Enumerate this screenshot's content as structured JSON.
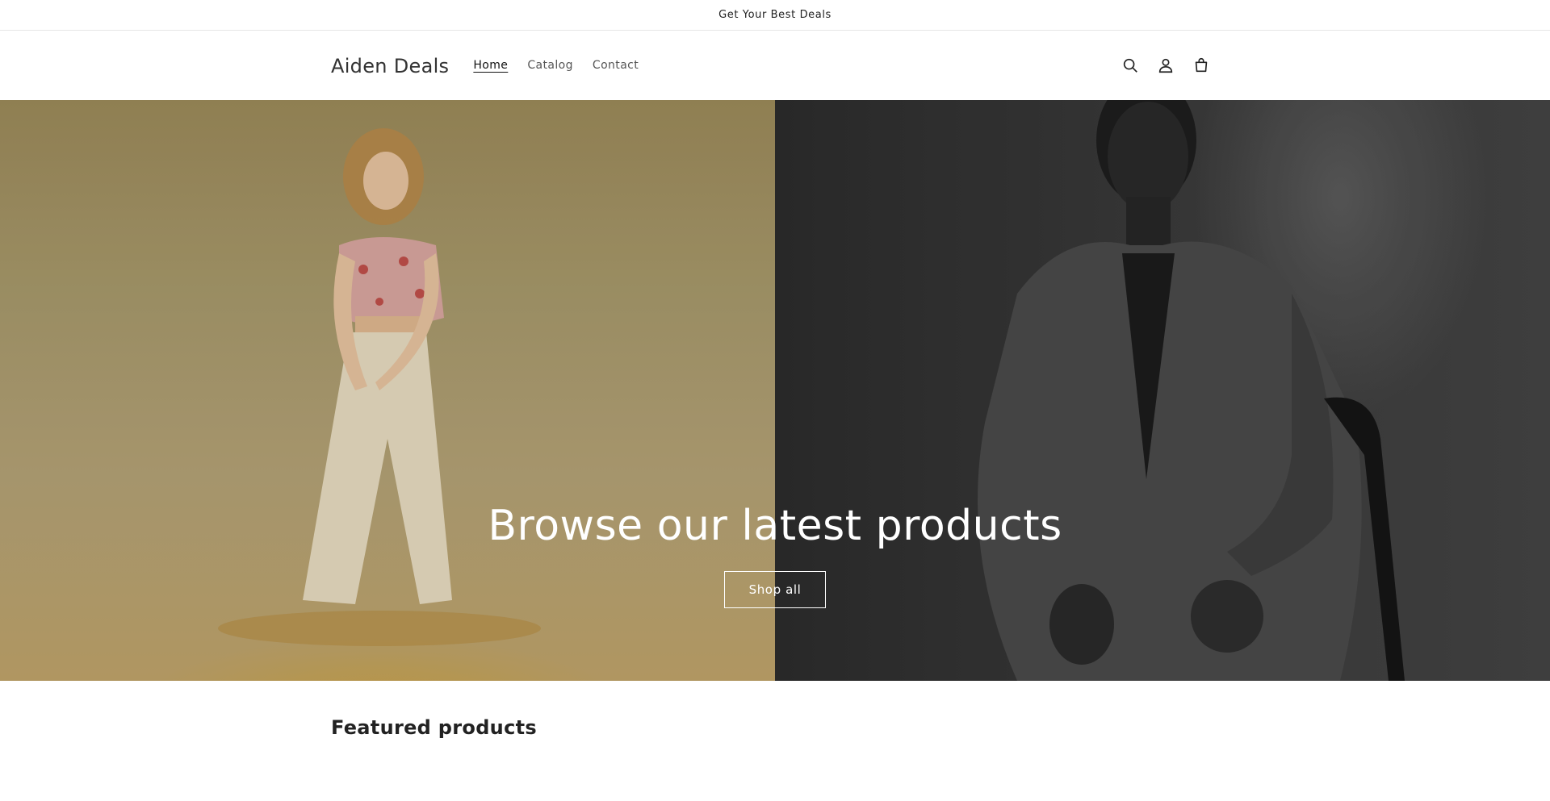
{
  "announcement": {
    "text": "Get Your Best Deals"
  },
  "header": {
    "logo": "Aiden Deals",
    "nav": [
      {
        "label": "Home",
        "active": true
      },
      {
        "label": "Catalog",
        "active": false
      },
      {
        "label": "Contact",
        "active": false
      }
    ],
    "icons": [
      "search-icon",
      "account-icon",
      "cart-icon"
    ]
  },
  "hero": {
    "title": "Browse our latest products",
    "button_label": "Shop all"
  },
  "featured": {
    "heading": "Featured products"
  },
  "colors": {
    "hero_left": "#a89a6c",
    "hero_right": "#3a3a3a",
    "text": "#121212",
    "white": "#ffffff"
  }
}
